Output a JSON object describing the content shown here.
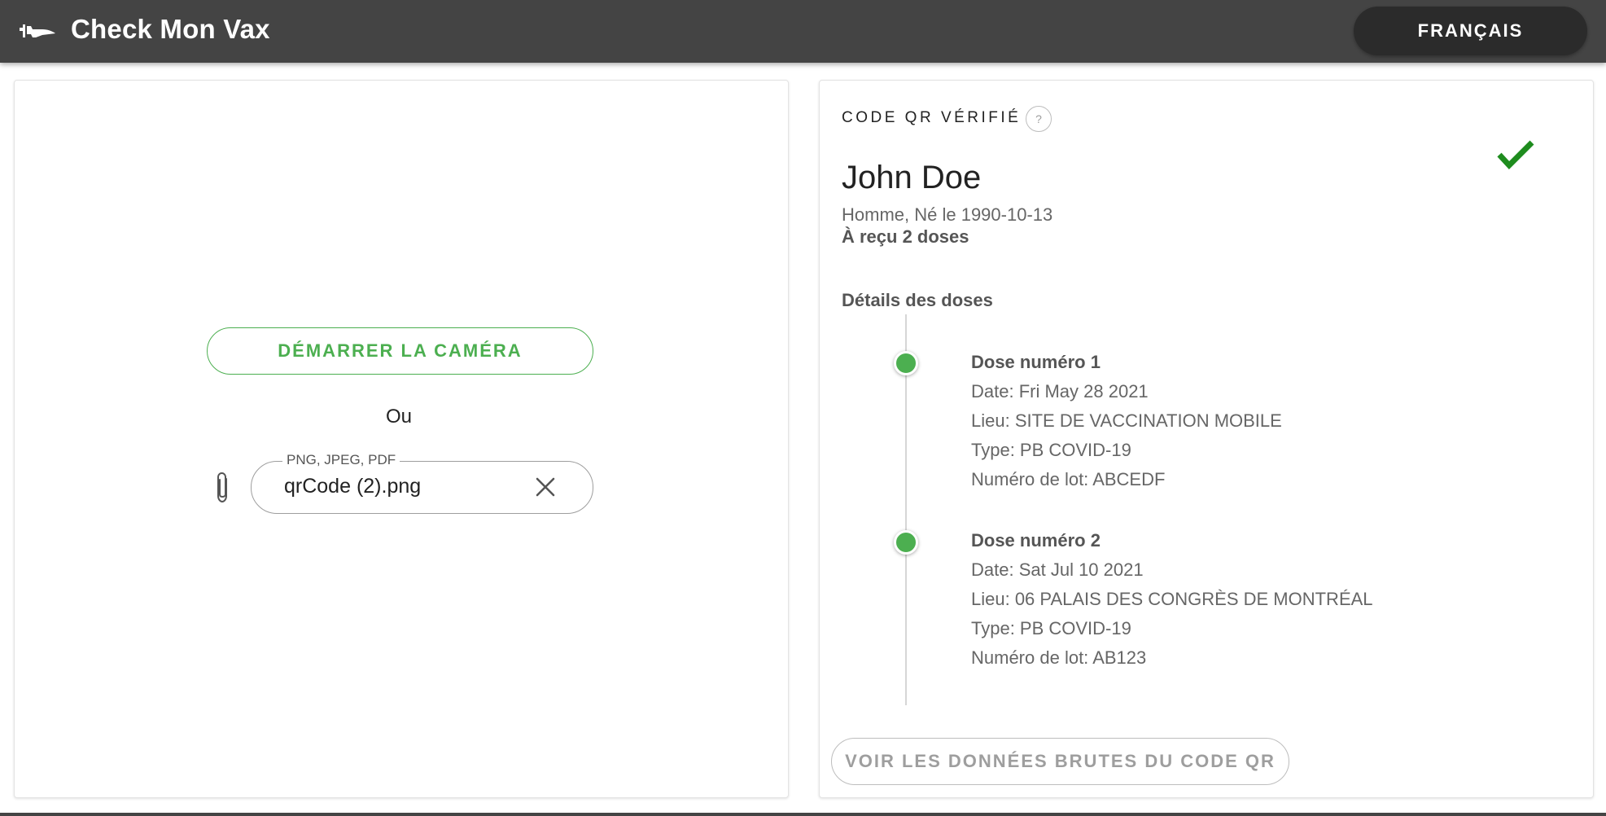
{
  "app": {
    "title": "Check Mon Vax",
    "language_button": "FRANÇAIS",
    "logo_icon": "quebec-logo-icon"
  },
  "scanner": {
    "camera_button": "DÉMARRER LA CAMÉRA",
    "or_label": "Ou",
    "file_input": {
      "legend": "PNG, JPEG, PDF",
      "value": "qrCode (2).png"
    },
    "icons": {
      "attach": "paperclip-icon",
      "clear": "close-icon"
    }
  },
  "result": {
    "status_label": "CODE QR VÉRIFIÉ",
    "help_label": "?",
    "verified_color": "#1e8c1e",
    "accent_color": "#4caf50",
    "patient": {
      "name": "John Doe",
      "info": "Homme, Né le 1990-10-13",
      "doses_summary": "À reçu 2 doses"
    },
    "dose_details_title": "Détails des doses",
    "doses": [
      {
        "title": "Dose numéro 1",
        "date": "Date: Fri May 28 2021",
        "location": "Lieu: SITE DE VACCINATION MOBILE",
        "type": "Type: PB COVID-19",
        "lot": "Numéro de lot: ABCEDF"
      },
      {
        "title": "Dose numéro 2",
        "date": "Date: Sat Jul 10 2021",
        "location": "Lieu: 06 PALAIS DES CONGRÈS DE MONTRÉAL",
        "type": "Type: PB COVID-19",
        "lot": "Numéro de lot: AB123"
      }
    ],
    "raw_data_button": "VOIR LES DONNÉES BRUTES DU CODE QR"
  }
}
